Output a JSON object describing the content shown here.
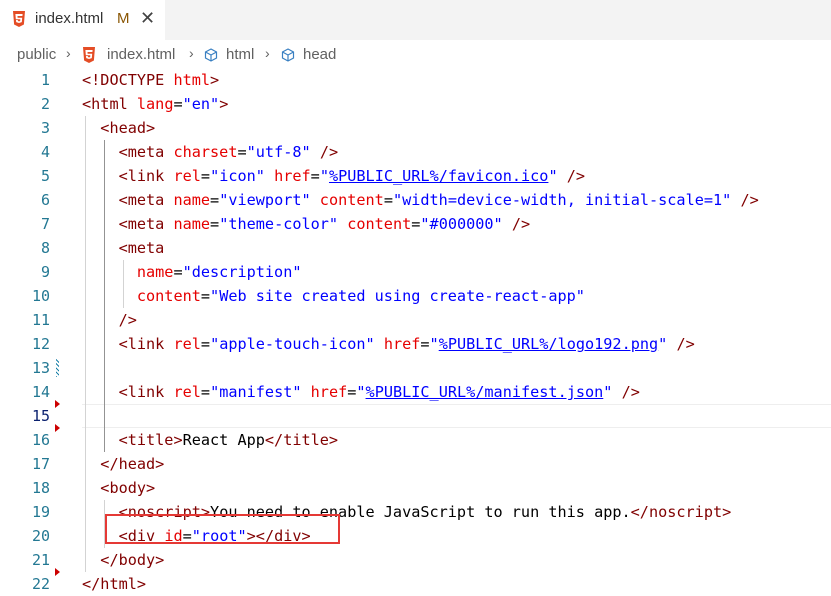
{
  "tab": {
    "filename": "index.html",
    "status": "M",
    "close": "✕"
  },
  "breadcrumb": {
    "items": [
      "public",
      "index.html",
      "html",
      "head"
    ],
    "separator": "›"
  },
  "editor": {
    "lines": [
      {
        "number": "1",
        "tokens": [
          {
            "c": "p",
            "t": "<!"
          },
          {
            "c": "t",
            "t": "DOCTYPE"
          },
          {
            "c": "",
            "t": " "
          },
          {
            "c": "a",
            "t": "html"
          },
          {
            "c": "p",
            "t": ">"
          }
        ]
      },
      {
        "number": "2",
        "tokens": [
          {
            "c": "p",
            "t": "<"
          },
          {
            "c": "t",
            "t": "html"
          },
          {
            "c": "",
            "t": " "
          },
          {
            "c": "a",
            "t": "lang"
          },
          {
            "c": "",
            "t": "="
          },
          {
            "c": "s",
            "t": "\"en\""
          },
          {
            "c": "p",
            "t": ">"
          }
        ]
      },
      {
        "number": "3",
        "tokens": [
          {
            "c": "",
            "t": "  "
          },
          {
            "c": "p",
            "t": "<"
          },
          {
            "c": "t",
            "t": "head"
          },
          {
            "c": "p",
            "t": ">"
          }
        ]
      },
      {
        "number": "4",
        "tokens": [
          {
            "c": "",
            "t": "    "
          },
          {
            "c": "p",
            "t": "<"
          },
          {
            "c": "t",
            "t": "meta"
          },
          {
            "c": "",
            "t": " "
          },
          {
            "c": "a",
            "t": "charset"
          },
          {
            "c": "",
            "t": "="
          },
          {
            "c": "s",
            "t": "\"utf-8\""
          },
          {
            "c": "",
            "t": " "
          },
          {
            "c": "p",
            "t": "/>"
          }
        ]
      },
      {
        "number": "5",
        "tokens": [
          {
            "c": "",
            "t": "    "
          },
          {
            "c": "p",
            "t": "<"
          },
          {
            "c": "t",
            "t": "link"
          },
          {
            "c": "",
            "t": " "
          },
          {
            "c": "a",
            "t": "rel"
          },
          {
            "c": "",
            "t": "="
          },
          {
            "c": "s",
            "t": "\"icon\""
          },
          {
            "c": "",
            "t": " "
          },
          {
            "c": "a",
            "t": "href"
          },
          {
            "c": "",
            "t": "="
          },
          {
            "c": "s",
            "t": "\""
          },
          {
            "c": "s u",
            "t": "%PUBLIC_URL%/favicon.ico"
          },
          {
            "c": "s",
            "t": "\""
          },
          {
            "c": "",
            "t": " "
          },
          {
            "c": "p",
            "t": "/>"
          }
        ]
      },
      {
        "number": "6",
        "tokens": [
          {
            "c": "",
            "t": "    "
          },
          {
            "c": "p",
            "t": "<"
          },
          {
            "c": "t",
            "t": "meta"
          },
          {
            "c": "",
            "t": " "
          },
          {
            "c": "a",
            "t": "name"
          },
          {
            "c": "",
            "t": "="
          },
          {
            "c": "s",
            "t": "\"viewport\""
          },
          {
            "c": "",
            "t": " "
          },
          {
            "c": "a",
            "t": "content"
          },
          {
            "c": "",
            "t": "="
          },
          {
            "c": "s",
            "t": "\"width=device-width, initial-scale=1\""
          },
          {
            "c": "",
            "t": " "
          },
          {
            "c": "p",
            "t": "/>"
          }
        ]
      },
      {
        "number": "7",
        "tokens": [
          {
            "c": "",
            "t": "    "
          },
          {
            "c": "p",
            "t": "<"
          },
          {
            "c": "t",
            "t": "meta"
          },
          {
            "c": "",
            "t": " "
          },
          {
            "c": "a",
            "t": "name"
          },
          {
            "c": "",
            "t": "="
          },
          {
            "c": "s",
            "t": "\"theme-color\""
          },
          {
            "c": "",
            "t": " "
          },
          {
            "c": "a",
            "t": "content"
          },
          {
            "c": "",
            "t": "="
          },
          {
            "c": "s",
            "t": "\"#000000\""
          },
          {
            "c": "",
            "t": " "
          },
          {
            "c": "p",
            "t": "/>"
          }
        ]
      },
      {
        "number": "8",
        "tokens": [
          {
            "c": "",
            "t": "    "
          },
          {
            "c": "p",
            "t": "<"
          },
          {
            "c": "t",
            "t": "meta"
          }
        ]
      },
      {
        "number": "9",
        "tokens": [
          {
            "c": "",
            "t": "      "
          },
          {
            "c": "a",
            "t": "name"
          },
          {
            "c": "",
            "t": "="
          },
          {
            "c": "s",
            "t": "\"description\""
          }
        ]
      },
      {
        "number": "10",
        "tokens": [
          {
            "c": "",
            "t": "      "
          },
          {
            "c": "a",
            "t": "content"
          },
          {
            "c": "",
            "t": "="
          },
          {
            "c": "s",
            "t": "\"Web site created using create-react-app\""
          }
        ]
      },
      {
        "number": "11",
        "tokens": [
          {
            "c": "",
            "t": "    "
          },
          {
            "c": "p",
            "t": "/>"
          }
        ]
      },
      {
        "number": "12",
        "tokens": [
          {
            "c": "",
            "t": "    "
          },
          {
            "c": "p",
            "t": "<"
          },
          {
            "c": "t",
            "t": "link"
          },
          {
            "c": "",
            "t": " "
          },
          {
            "c": "a",
            "t": "rel"
          },
          {
            "c": "",
            "t": "="
          },
          {
            "c": "s",
            "t": "\"apple-touch-icon\""
          },
          {
            "c": "",
            "t": " "
          },
          {
            "c": "a",
            "t": "href"
          },
          {
            "c": "",
            "t": "="
          },
          {
            "c": "s",
            "t": "\""
          },
          {
            "c": "s u",
            "t": "%PUBLIC_URL%/logo192.png"
          },
          {
            "c": "s",
            "t": "\""
          },
          {
            "c": "",
            "t": " "
          },
          {
            "c": "p",
            "t": "/>"
          }
        ]
      },
      {
        "number": "13",
        "tokens": []
      },
      {
        "number": "14",
        "tokens": [
          {
            "c": "",
            "t": "    "
          },
          {
            "c": "p",
            "t": "<"
          },
          {
            "c": "t",
            "t": "link"
          },
          {
            "c": "",
            "t": " "
          },
          {
            "c": "a",
            "t": "rel"
          },
          {
            "c": "",
            "t": "="
          },
          {
            "c": "s",
            "t": "\"manifest\""
          },
          {
            "c": "",
            "t": " "
          },
          {
            "c": "a",
            "t": "href"
          },
          {
            "c": "",
            "t": "="
          },
          {
            "c": "s",
            "t": "\""
          },
          {
            "c": "s u",
            "t": "%PUBLIC_URL%/manifest.json"
          },
          {
            "c": "s",
            "t": "\""
          },
          {
            "c": "",
            "t": " "
          },
          {
            "c": "p",
            "t": "/>"
          }
        ]
      },
      {
        "number": "15",
        "tokens": []
      },
      {
        "number": "16",
        "tokens": [
          {
            "c": "",
            "t": "    "
          },
          {
            "c": "p",
            "t": "<"
          },
          {
            "c": "t",
            "t": "title"
          },
          {
            "c": "p",
            "t": ">"
          },
          {
            "c": "",
            "t": "React App"
          },
          {
            "c": "p",
            "t": "</"
          },
          {
            "c": "t",
            "t": "title"
          },
          {
            "c": "p",
            "t": ">"
          }
        ]
      },
      {
        "number": "17",
        "tokens": [
          {
            "c": "",
            "t": "  "
          },
          {
            "c": "p",
            "t": "</"
          },
          {
            "c": "t",
            "t": "head"
          },
          {
            "c": "p",
            "t": ">"
          }
        ]
      },
      {
        "number": "18",
        "tokens": [
          {
            "c": "",
            "t": "  "
          },
          {
            "c": "p",
            "t": "<"
          },
          {
            "c": "t",
            "t": "body"
          },
          {
            "c": "p",
            "t": ">"
          }
        ]
      },
      {
        "number": "19",
        "tokens": [
          {
            "c": "",
            "t": "    "
          },
          {
            "c": "p",
            "t": "<"
          },
          {
            "c": "t",
            "t": "noscript"
          },
          {
            "c": "p",
            "t": ">"
          },
          {
            "c": "",
            "t": "You need to enable JavaScript to run this app."
          },
          {
            "c": "p",
            "t": "</"
          },
          {
            "c": "t",
            "t": "noscript"
          },
          {
            "c": "p",
            "t": ">"
          }
        ]
      },
      {
        "number": "20",
        "tokens": [
          {
            "c": "",
            "t": "    "
          },
          {
            "c": "p",
            "t": "<"
          },
          {
            "c": "t",
            "t": "div"
          },
          {
            "c": "",
            "t": " "
          },
          {
            "c": "a",
            "t": "id"
          },
          {
            "c": "",
            "t": "="
          },
          {
            "c": "s",
            "t": "\"root\""
          },
          {
            "c": "p",
            "t": "></"
          },
          {
            "c": "t",
            "t": "div"
          },
          {
            "c": "p",
            "t": ">"
          }
        ]
      },
      {
        "number": "21",
        "tokens": [
          {
            "c": "",
            "t": "  "
          },
          {
            "c": "p",
            "t": "</"
          },
          {
            "c": "t",
            "t": "body"
          },
          {
            "c": "p",
            "t": ">"
          }
        ]
      },
      {
        "number": "22",
        "tokens": [
          {
            "c": "p",
            "t": "</"
          },
          {
            "c": "t",
            "t": "html"
          },
          {
            "c": "p",
            "t": ">"
          }
        ]
      }
    ]
  },
  "colors": {
    "tag": "#800000",
    "attribute": "#e50000",
    "string": "#0000ff",
    "line_number": "#237893",
    "highlight_box": "#e53935",
    "html5_icon": "#e44d26"
  }
}
